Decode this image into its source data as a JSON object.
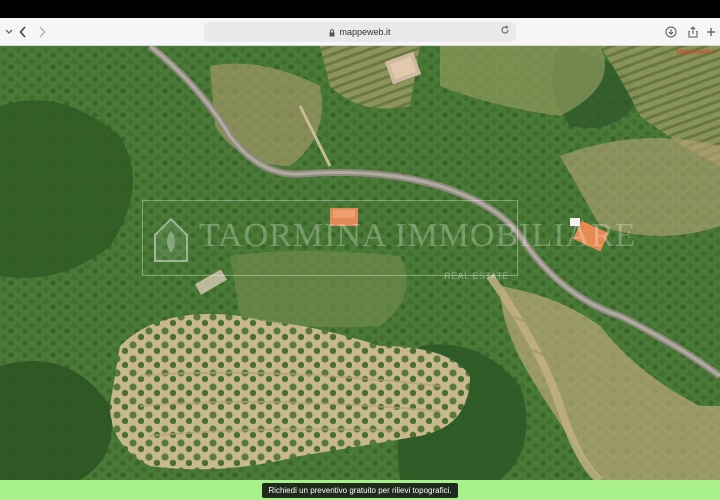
{
  "browser": {
    "url": "mappeweb.it",
    "icons": {
      "sidebar": "chevron-down-icon",
      "back": "back-arrow-icon",
      "forward": "forward-arrow-icon",
      "lock": "lock-icon",
      "reload": "reload-icon",
      "download": "download-icon",
      "share": "share-icon",
      "new_tab": "plus-icon"
    }
  },
  "map": {
    "corner_label": "Mappeweb.it",
    "watermark_title": "TAORMINA IMMOBILIARE",
    "watermark_subtitle": "REAL ESTATE"
  },
  "footer": {
    "cta_label": "Richiedi un preventivo gratuito per rilievi topografici."
  },
  "colors": {
    "footer_bg": "#a7f08a",
    "cta_bg": "#1f2a1d",
    "corner_label": "#e03a2a"
  }
}
